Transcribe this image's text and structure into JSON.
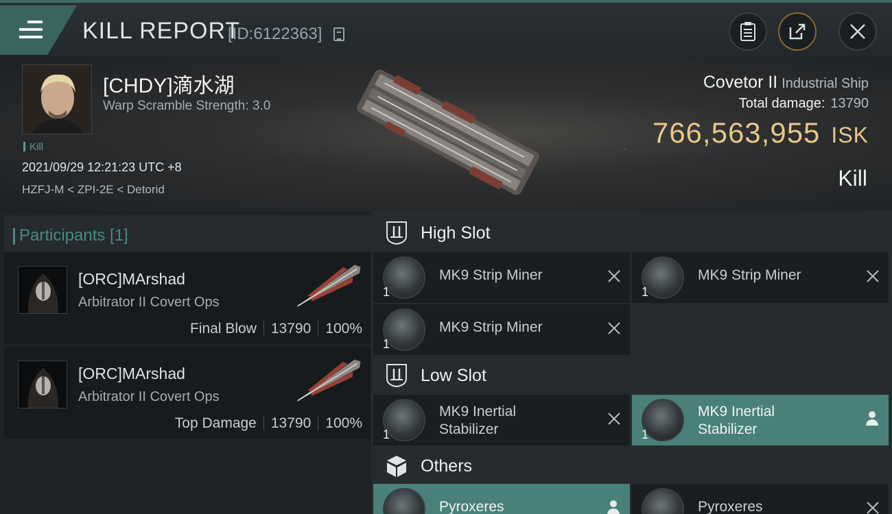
{
  "header": {
    "title": "KILL REPORT",
    "report_id": "[ID:6122363]",
    "icons": [
      "menu-icon",
      "copy-icon",
      "clipboard-icon",
      "share-icon",
      "close-icon"
    ]
  },
  "victim": {
    "name": "[CHDY]滴水湖",
    "warp_scramble": "Warp Scramble Strength: 3.0",
    "tag": "Kill",
    "datetime": "2021/09/29 12:21:23 UTC +8",
    "location": "HZFJ-M < ZPI-2E < Detorid",
    "ship_name": "Covetor II",
    "ship_class": "Industrial Ship",
    "total_damage_label": "Total damage:",
    "total_damage": "13790",
    "isk_value": "766,563,955",
    "isk_unit": "ISK",
    "result": "Kill"
  },
  "participants": {
    "header": "Participants [1]",
    "items": [
      {
        "name": "[ORC]MArshad",
        "ship": "Arbitrator II Covert Ops",
        "role": "Final Blow",
        "damage": "13790",
        "percent": "100%"
      },
      {
        "name": "[ORC]MArshad",
        "ship": "Arbitrator II Covert Ops",
        "role": "Top Damage",
        "damage": "13790",
        "percent": "100%"
      }
    ]
  },
  "fitting": {
    "high_slot": {
      "label": "High Slot",
      "modules": [
        {
          "name": "MK9 Strip Miner",
          "qty": "1",
          "action": "destroyed"
        },
        {
          "name": "MK9 Strip Miner",
          "qty": "1",
          "action": "destroyed"
        },
        {
          "name": "MK9 Strip Miner",
          "qty": "1",
          "action": "destroyed"
        }
      ]
    },
    "low_slot": {
      "label": "Low Slot",
      "modules": [
        {
          "name_line1": "MK9 Inertial",
          "name_line2": "Stabilizer",
          "qty": "1",
          "action": "destroyed"
        },
        {
          "name_line1": "MK9 Inertial",
          "name_line2": "Stabilizer",
          "qty": "1",
          "action": "dropped"
        }
      ]
    },
    "others": {
      "label": "Others",
      "modules": [
        {
          "name": "Pyroxeres",
          "qty": "",
          "action": "dropped"
        },
        {
          "name": "Pyroxeres",
          "qty": "",
          "action": "destroyed"
        }
      ]
    }
  },
  "colors": {
    "accent_teal": "#4a807a",
    "isk_gold": "#e8c78a",
    "background": "#1c2024"
  }
}
